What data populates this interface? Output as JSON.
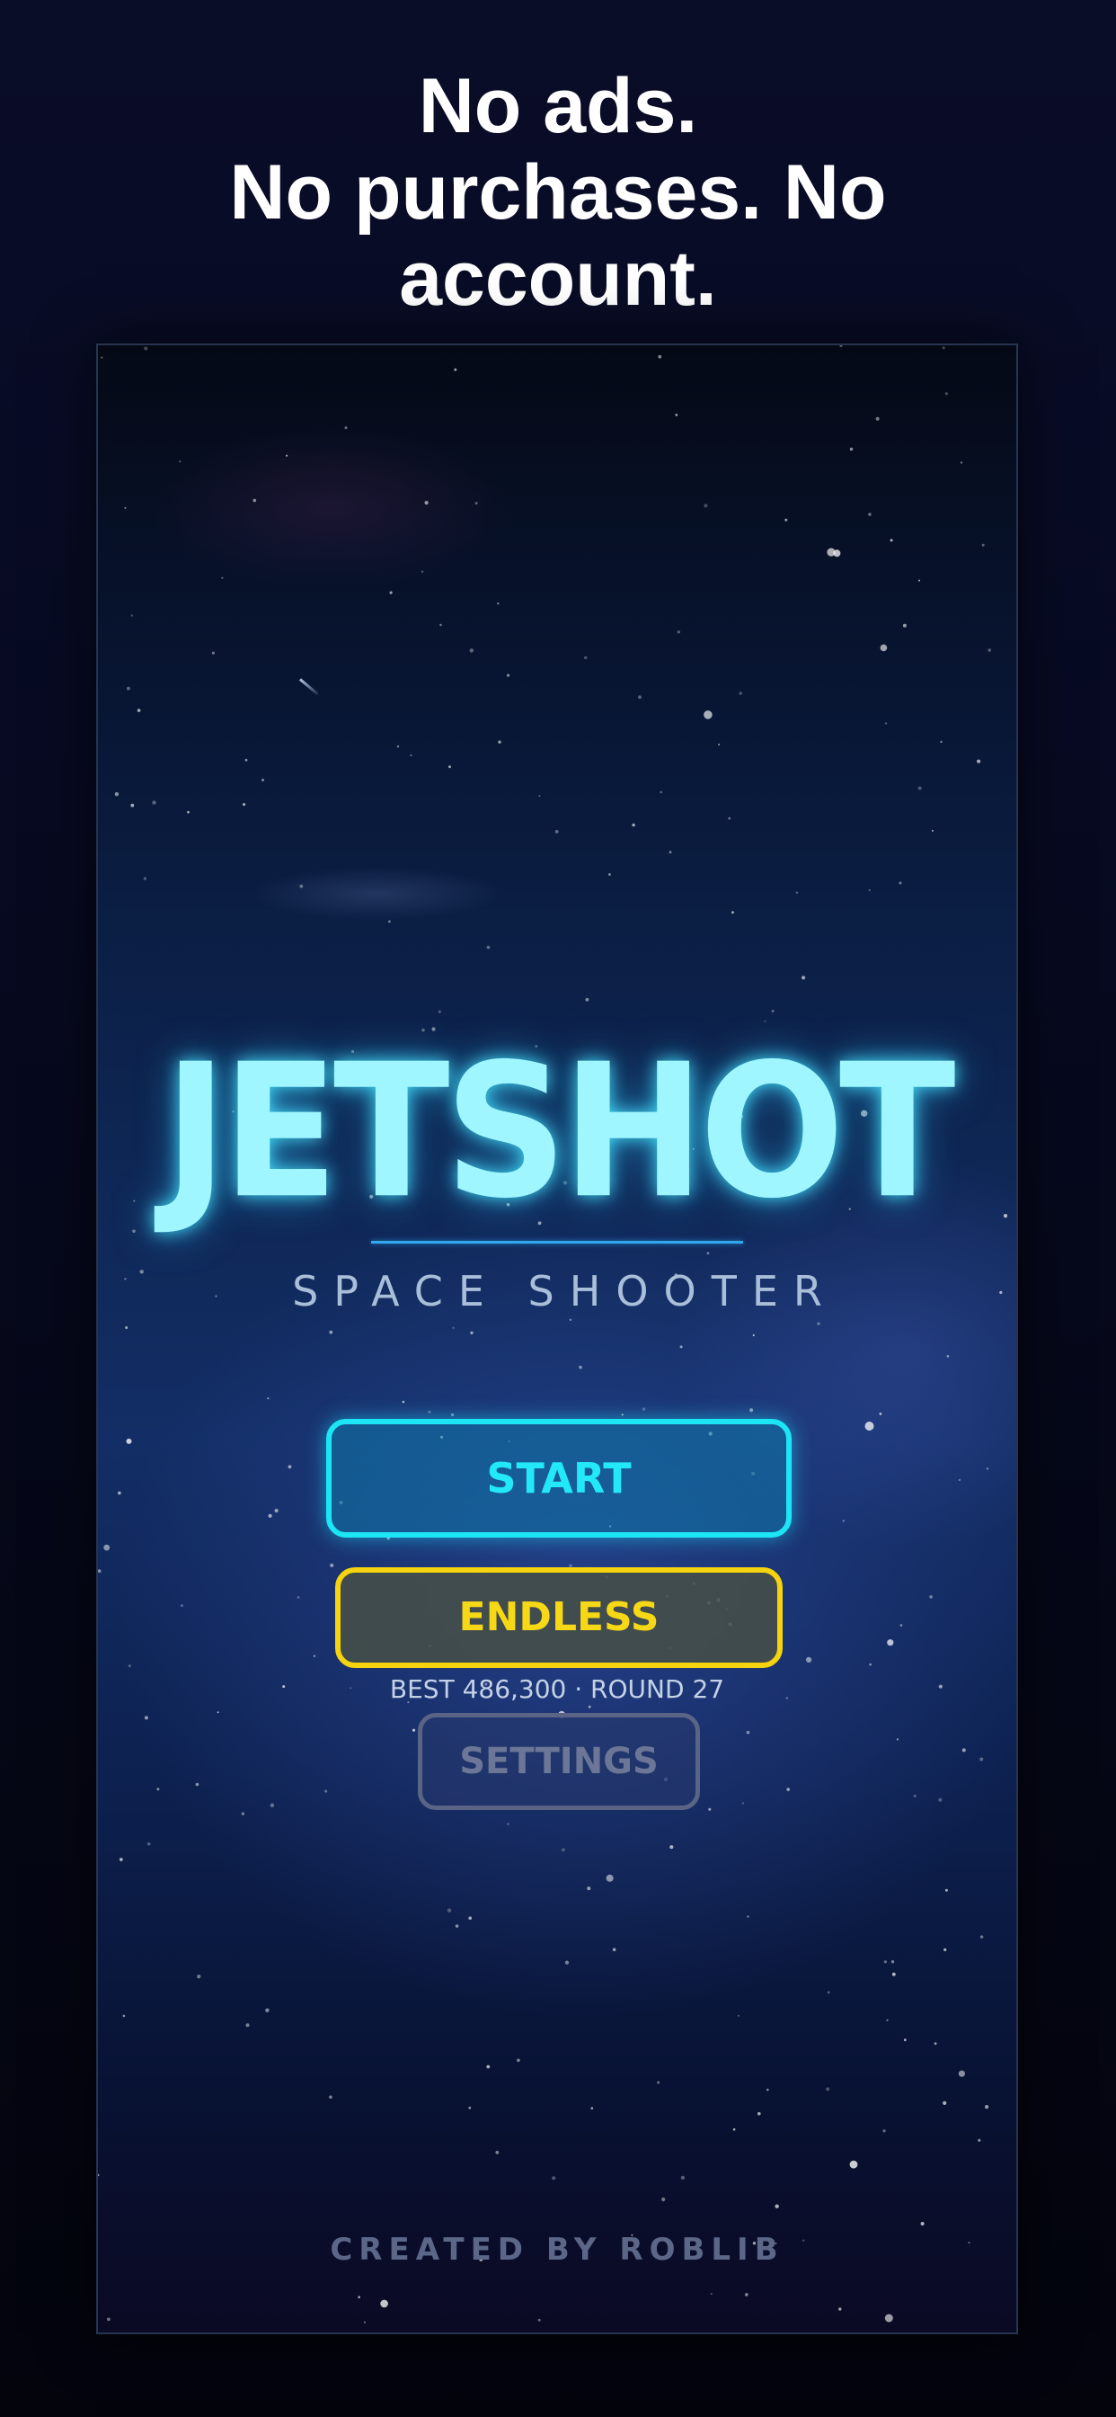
{
  "promo": {
    "line1": "No ads.",
    "line2": "No purchases. No",
    "line3": "account."
  },
  "game": {
    "title": "JETSHOT",
    "subtitle": "SPACE SHOOTER",
    "start_label": "START",
    "endless_label": "ENDLESS",
    "best_text": "BEST 486,300 · ROUND 27",
    "settings_label": "SETTINGS",
    "credit": "CREATED BY ROBLIB"
  },
  "colors": {
    "title_glow": "#9ff6ff",
    "start_accent": "#1ce6f5",
    "endless_accent": "#f5d30f",
    "settings_accent": "#5a6485"
  }
}
